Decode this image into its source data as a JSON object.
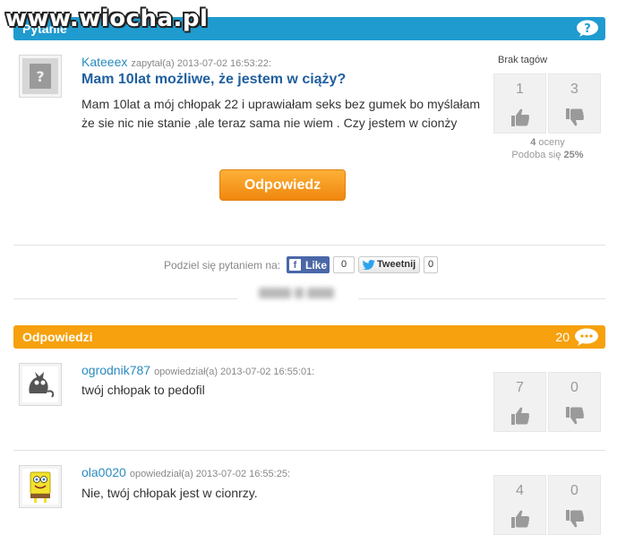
{
  "watermark": "www.wiocha.pl",
  "question_section": {
    "title": "Pytanie"
  },
  "question": {
    "author": "Kateeex",
    "meta": "zapytał(a) 2013-07-02 16:53:22:",
    "title": "Mam 10lat możliwe, że jestem w ciąży?",
    "body": "Mam 10lat a mój chłopak 22 i uprawiałam seks bez gumek bo myślałam że sie nic nie stanie ,ale teraz sama nie wiem . Czy jestem w cionży",
    "tags_label": "Brak tagów",
    "votes_up": "1",
    "votes_down": "3",
    "ratings_count": "4",
    "ratings_label": "oceny",
    "likes_label": "Podoba się",
    "likes_percent": "25%",
    "answer_button": "Odpowiedz"
  },
  "share": {
    "label": "Podziel się pytaniem na:",
    "fb_label": "Like",
    "fb_count": "0",
    "tw_label": "Tweetnij",
    "tw_count": "0"
  },
  "answers_section": {
    "title": "Odpowiedzi",
    "count": "20"
  },
  "answers": [
    {
      "author": "ogrodnik787",
      "meta": "opowiedział(a) 2013-07-02 16:55:01:",
      "text": "twój chłopak to pedofil",
      "votes_up": "7",
      "votes_down": "0"
    },
    {
      "author": "ola0020",
      "meta": "opowiedział(a) 2013-07-02 16:55:25:",
      "text": "Nie, twój chłopak jest w cionrzy.",
      "votes_up": "4",
      "votes_down": "0"
    }
  ],
  "colors": {
    "blue_bar": "#1f9bcf",
    "orange_bar": "#f6a10d",
    "link": "#2a8bc1",
    "title": "#1f5f9e"
  },
  "icons": [
    "question-mark-icon",
    "speech-bubble-icon",
    "thumb-up-icon",
    "thumb-down-icon",
    "facebook-icon",
    "twitter-bird-icon"
  ]
}
